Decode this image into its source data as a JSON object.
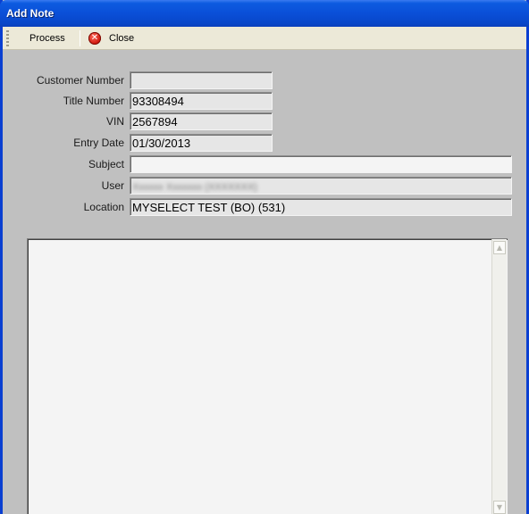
{
  "window": {
    "title": "Add Note"
  },
  "toolbar": {
    "process_label": "Process",
    "close_label": "Close",
    "close_icon": "close-circle-icon"
  },
  "form": {
    "customer_number": {
      "label": "Customer Number",
      "value": ""
    },
    "title_number": {
      "label": "Title Number",
      "value": "93308494"
    },
    "vin": {
      "label": "VIN",
      "value": "2567894"
    },
    "entry_date": {
      "label": "Entry Date",
      "value": "01/30/2013"
    },
    "subject": {
      "label": "Subject",
      "value": ""
    },
    "user": {
      "label": "User",
      "value": "Xxxxxx Xxxxxxx (XXXXXXX)"
    },
    "location": {
      "label": "Location",
      "value": "MYSELECT TEST (BO) (531)"
    }
  },
  "note_body": {
    "value": ""
  },
  "colors": {
    "titlebar": "#0a4fd8",
    "toolbar": "#ece9d8",
    "form_background": "#c0c0c0"
  }
}
